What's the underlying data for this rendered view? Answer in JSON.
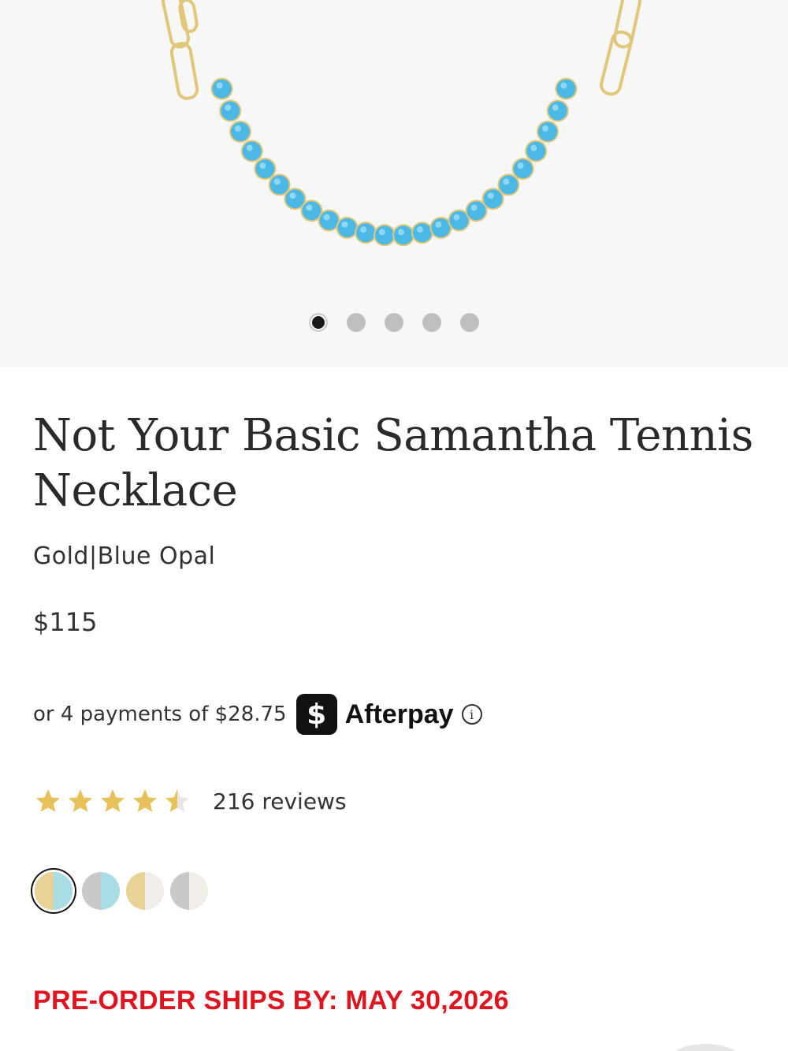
{
  "carousel": {
    "total": 5,
    "active": 0
  },
  "product": {
    "title": "Not Your Basic Samantha Tennis Necklace",
    "variant": "Gold|Blue Opal",
    "price": "$115"
  },
  "afterpay": {
    "text": "or 4 payments of $28.75",
    "logo_symbol": "$",
    "brand": "Afterpay",
    "info_symbol": "i"
  },
  "rating": {
    "stars": 4.5,
    "reviews_label": "216 reviews"
  },
  "swatches": [
    {
      "name": "gold-blue-opal",
      "left": "#e8d295",
      "right": "#a9dde6",
      "selected": true
    },
    {
      "name": "silver-blue-opal",
      "left": "#c9c9c9",
      "right": "#a9dde6",
      "selected": false
    },
    {
      "name": "gold-white",
      "left": "#e8d295",
      "right": "#f1eeea",
      "selected": false
    },
    {
      "name": "silver-white",
      "left": "#c9c9c9",
      "right": "#f1eeea",
      "selected": false
    }
  ],
  "preorder": "PRE-ORDER SHIPS BY: MAY 30,2026",
  "colors": {
    "gem": "#4bb8e6",
    "gold": "#e2c77a",
    "star": "#e8c15a",
    "preorder": "#e0141e"
  }
}
